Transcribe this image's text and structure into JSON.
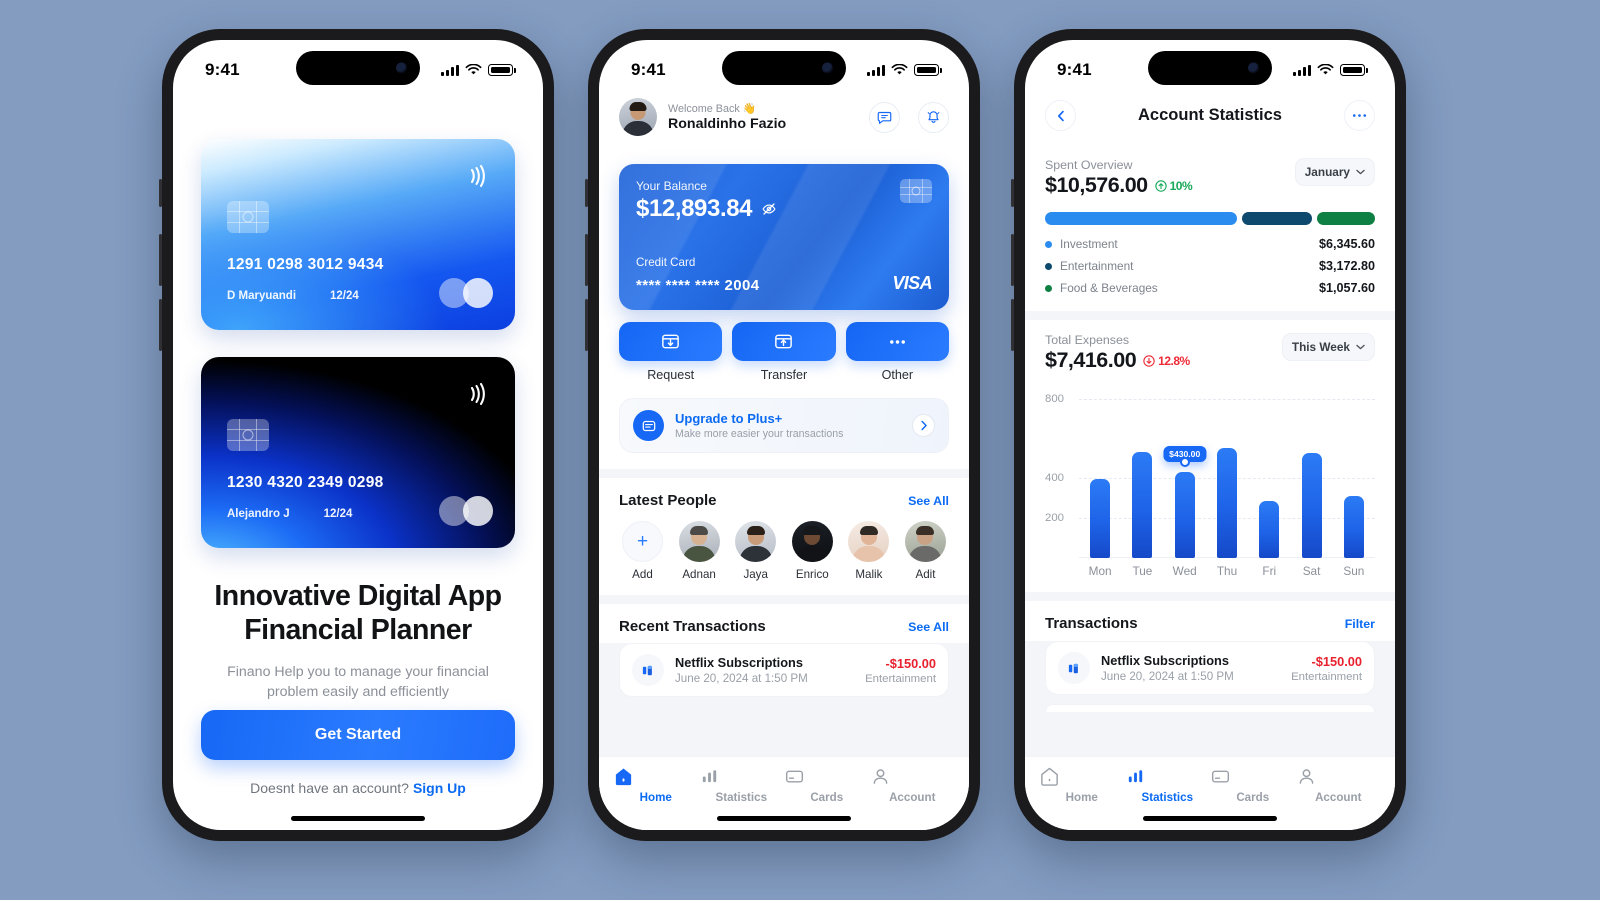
{
  "phone1": {
    "status": {
      "time": "9:41"
    },
    "cards": [
      {
        "number": "1291 0298 3012 9434",
        "holder": "D Maryuandi",
        "expiry": "12/24",
        "style": "blue"
      },
      {
        "number": "1230 4320 2349 0298",
        "holder": "Alejandro J",
        "expiry": "12/24",
        "style": "dark"
      }
    ],
    "headline": "Innovative Digital App Financial Planner",
    "subtitle": "Finano Help you to manage your financial problem easily and efficiently",
    "cta": "Get Started",
    "footer_text": "Doesnt have an account?",
    "footer_link": "Sign Up"
  },
  "phone2": {
    "status": {
      "time": "9:41"
    },
    "header": {
      "welcome": "Welcome Back",
      "welcome_emoji": "👋",
      "name": "Ronaldinho Fazio"
    },
    "balance_card": {
      "label": "Your Balance",
      "amount": "$12,893.84",
      "card_type": "Credit Card",
      "masked_number": "**** **** **** 2004",
      "brand": "VISA"
    },
    "actions": [
      {
        "label": "Request",
        "icon": "card-download-icon"
      },
      {
        "label": "Transfer",
        "icon": "card-upload-icon"
      },
      {
        "label": "Other",
        "icon": "ellipsis-icon"
      }
    ],
    "upgrade": {
      "title": "Upgrade to Plus+",
      "subtitle": "Make more easier your transactions"
    },
    "latest_people": {
      "title": "Latest People",
      "see_all": "See All",
      "items": [
        {
          "name": "Add",
          "type": "add"
        },
        {
          "name": "Adnan",
          "skin": "#d6b293",
          "hair": "#4b4a46",
          "shirt": "#4a5541"
        },
        {
          "name": "Jaya",
          "skin": "#c99b78",
          "hair": "#2b2119",
          "shirt": "#2d3138"
        },
        {
          "name": "Enrico",
          "skin": "#6d4a33",
          "hair": "#15171a",
          "shirt": "#111317"
        },
        {
          "name": "Malik",
          "skin": "#e0b497",
          "hair": "#2f2a24",
          "shirt": "#e7c3ab"
        },
        {
          "name": "Adit",
          "skin": "#c9a184",
          "hair": "#3a2f26",
          "shirt": "#6a6b68"
        }
      ]
    },
    "recent": {
      "title": "Recent Transactions",
      "see_all": "See All",
      "items": [
        {
          "name": "Netflix Subscriptions",
          "date": "June 20, 2024 at 1:50 PM",
          "amount": "-$150.00",
          "category": "Entertainment"
        }
      ]
    },
    "tabs": [
      {
        "label": "Home",
        "icon": "home-icon",
        "active": true
      },
      {
        "label": "Statistics",
        "icon": "bar-chart-icon",
        "active": false
      },
      {
        "label": "Cards",
        "icon": "card-icon",
        "active": false
      },
      {
        "label": "Account",
        "icon": "user-icon",
        "active": false
      }
    ]
  },
  "phone3": {
    "status": {
      "time": "9:41"
    },
    "nav": {
      "title": "Account Statistics",
      "back": "back-icon",
      "more": "more-icon"
    },
    "spent_overview": {
      "label": "Spent Overview",
      "amount": "$10,576.00",
      "delta": "10%",
      "delta_direction": "up",
      "period": "January",
      "segments": [
        {
          "name": "Investment",
          "value": "$6,345.60",
          "color": "#2B8CF0",
          "pct": 60
        },
        {
          "name": "Entertainment",
          "value": "$3,172.80",
          "color": "#0E4A6E",
          "pct": 22
        },
        {
          "name": "Food & Beverages",
          "value": "$1,057.60",
          "color": "#0F8043",
          "pct": 18
        }
      ]
    },
    "total_expenses": {
      "label": "Total Expenses",
      "amount": "$7,416.00",
      "delta": "12.8%",
      "delta_direction": "down",
      "period": "This Week"
    },
    "transactions": {
      "title": "Transactions",
      "filter": "Filter",
      "items": [
        {
          "name": "Netflix Subscriptions",
          "date": "June 20, 2024 at 1:50 PM",
          "amount": "-$150.00",
          "category": "Entertainment"
        }
      ]
    },
    "tabs": [
      {
        "label": "Home",
        "icon": "home-icon",
        "active": false
      },
      {
        "label": "Statistics",
        "icon": "bar-chart-icon",
        "active": true
      },
      {
        "label": "Cards",
        "icon": "card-icon",
        "active": false
      },
      {
        "label": "Account",
        "icon": "user-icon",
        "active": false
      }
    ]
  },
  "chart_data": {
    "type": "bar",
    "title": "Total Expenses",
    "categories": [
      "Mon",
      "Tue",
      "Wed",
      "Thu",
      "Fri",
      "Sat",
      "Sun"
    ],
    "values": [
      395,
      535,
      430,
      555,
      285,
      530,
      310
    ],
    "xlabel": "",
    "ylabel": "",
    "ylim": [
      0,
      880
    ],
    "yticks": [
      200,
      400,
      800
    ],
    "ytick_labels": [
      "200",
      "400",
      "800"
    ],
    "grid": true,
    "legend": false,
    "highlight": {
      "category": "Wed",
      "label": "$430.00",
      "value": 430
    },
    "bar_color": "#1E63E8"
  },
  "theme": {
    "background": "#839CC0",
    "accent": "#0B6BF2",
    "positive": "#17A957",
    "negative": "#ED2B37"
  }
}
